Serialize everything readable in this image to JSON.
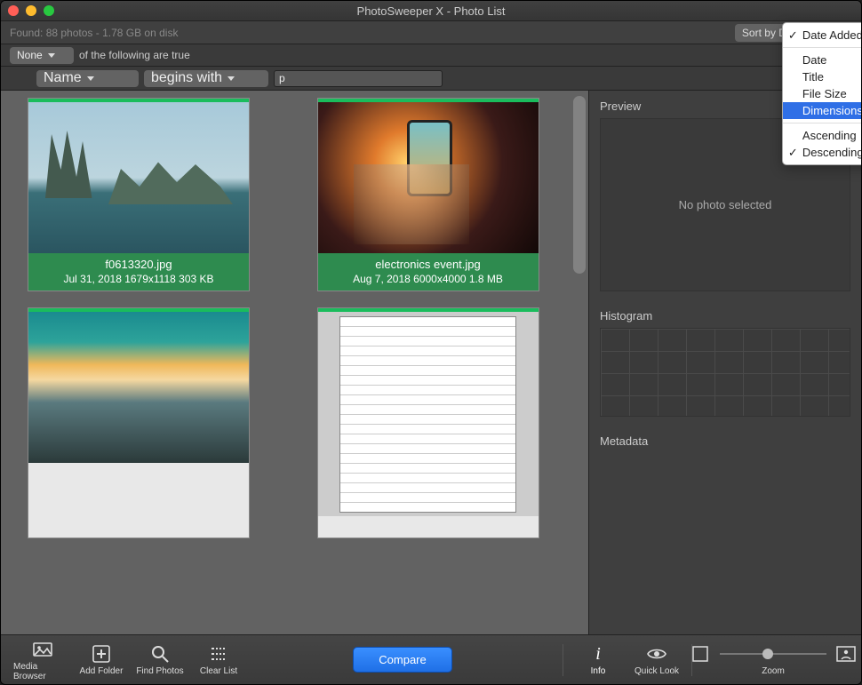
{
  "window_title": "PhotoSweeper X - Photo List",
  "status": "Found: 88 photos - 1.78 GB on disk",
  "sort_button": "Sort by Date Added",
  "filter": {
    "match": "None",
    "match_tail": "of the following are true",
    "field": "Name",
    "operator": "begins with",
    "value": "p"
  },
  "sort_menu": {
    "items": [
      "Date Added",
      "Date",
      "Title",
      "File Size",
      "Dimensions"
    ],
    "highlighted": "Dimensions",
    "checked_top": "Date Added",
    "order": [
      "Ascending",
      "Descending"
    ],
    "checked_order": "Descending"
  },
  "photos": [
    {
      "filename": "f0613320.jpg",
      "meta": "Jul 31, 2018  1679x1118  303 KB"
    },
    {
      "filename": "electronics event.jpg",
      "meta": "Aug 7, 2018  6000x4000  1.8 MB"
    }
  ],
  "sidebar": {
    "preview_title": "Preview",
    "preview_msg": "No photo selected",
    "hist_title": "Histogram",
    "meta_title": "Metadata"
  },
  "toolbar": {
    "media": "Media Browser",
    "add": "Add Folder",
    "find": "Find Photos",
    "clear": "Clear List",
    "compare": "Compare",
    "info": "Info",
    "quick": "Quick Look",
    "zoom": "Zoom"
  }
}
